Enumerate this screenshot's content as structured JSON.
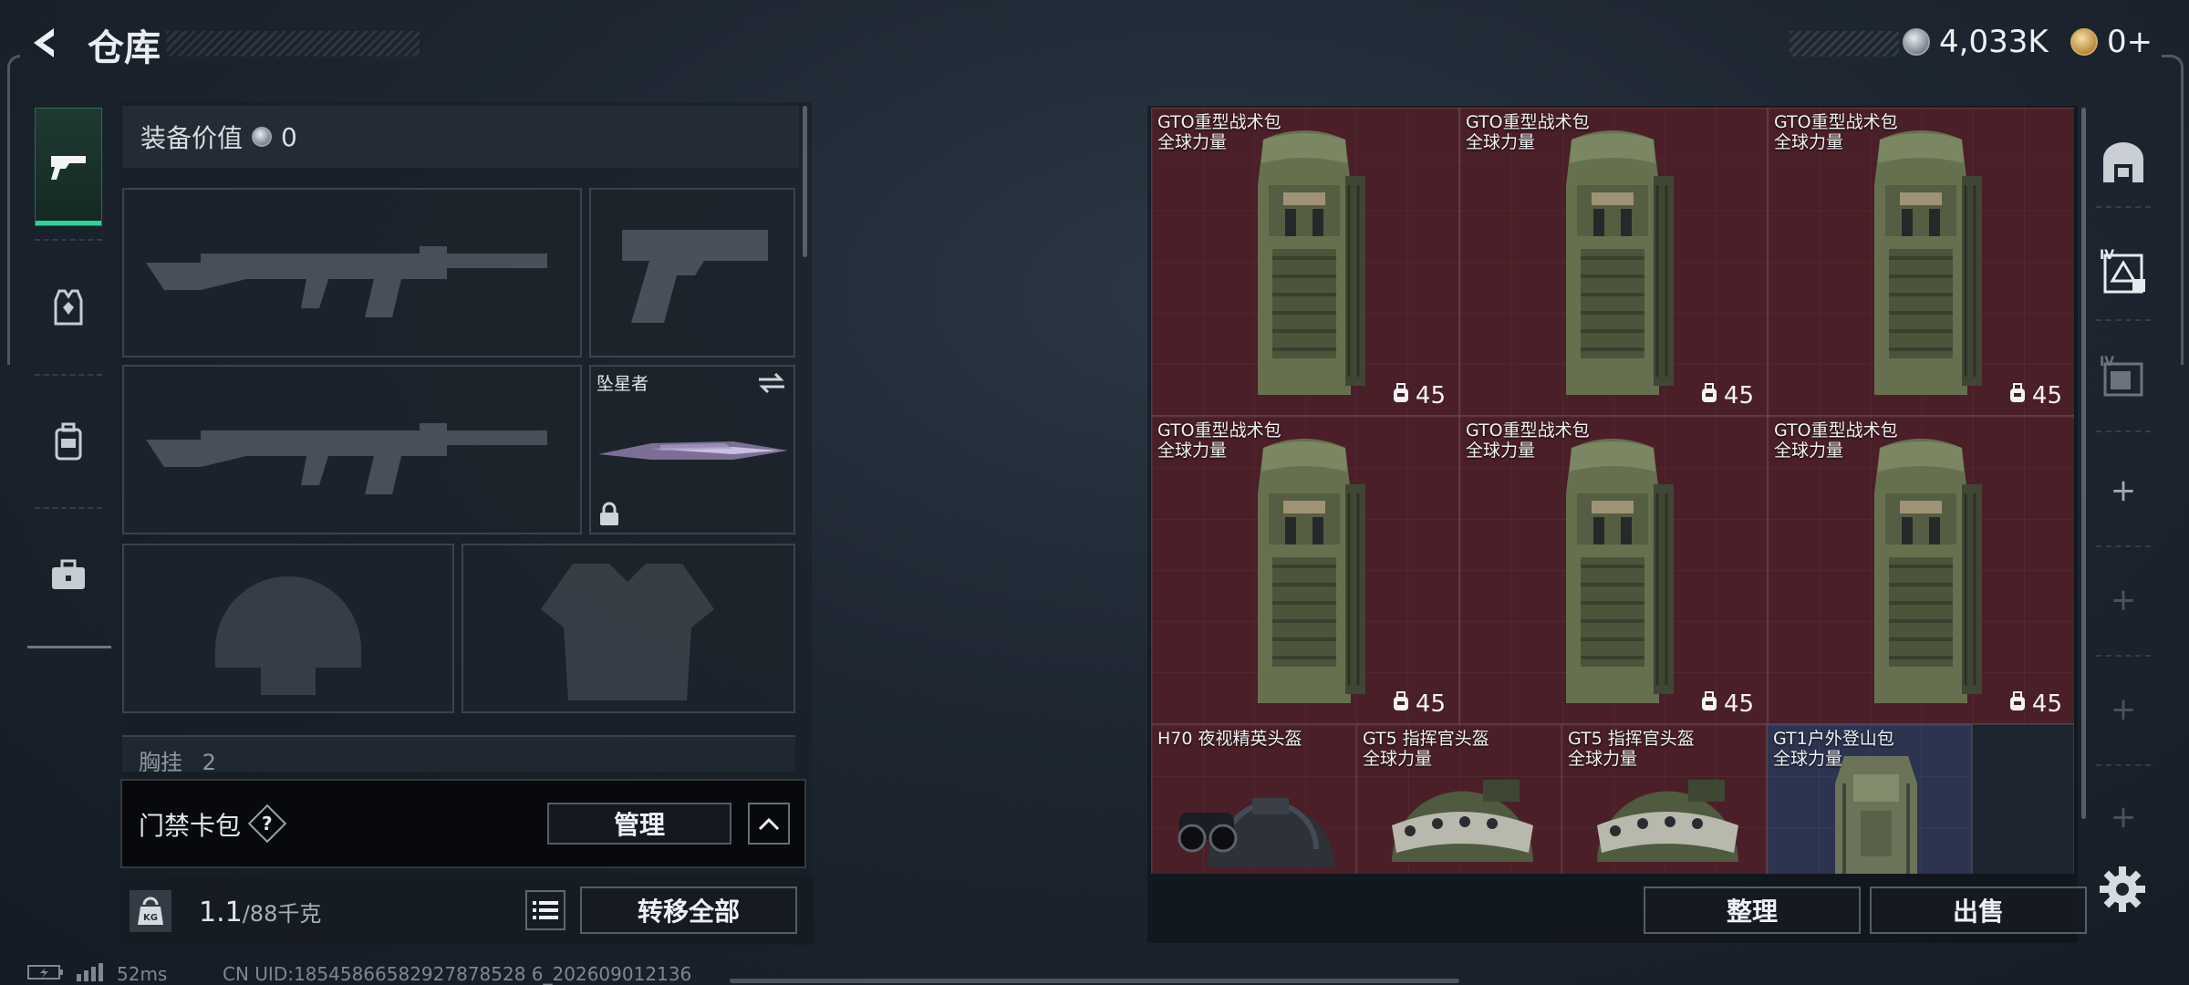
{
  "header": {
    "title": "仓库",
    "currency_silver": "4,033K",
    "currency_gold": "0+"
  },
  "equipment": {
    "value_label": "装备价值",
    "value": "0",
    "melee_name": "坠星者",
    "chest_label": "胸挂",
    "chest_value": "2"
  },
  "card_pack": {
    "label": "门禁卡包",
    "help": "?",
    "manage_label": "管理"
  },
  "weight": {
    "current": "1.1",
    "max": "/88千克",
    "kg_icon_text": "KG",
    "transfer_all_label": "转移全部"
  },
  "stash": {
    "items": [
      {
        "name": "GTO重型战术包",
        "sub": "全球力量",
        "cap": "45",
        "icon": "backpack-icon"
      },
      {
        "name": "GTO重型战术包",
        "sub": "全球力量",
        "cap": "45",
        "icon": "backpack-icon"
      },
      {
        "name": "GTO重型战术包",
        "sub": "全球力量",
        "cap": "45",
        "icon": "backpack-icon"
      },
      {
        "name": "GTO重型战术包",
        "sub": "全球力量",
        "cap": "45",
        "icon": "backpack-icon"
      },
      {
        "name": "GTO重型战术包",
        "sub": "全球力量",
        "cap": "45",
        "icon": "backpack-icon"
      },
      {
        "name": "GTO重型战术包",
        "sub": "全球力量",
        "cap": "45",
        "icon": "backpack-icon"
      },
      {
        "name": "H70 夜视精英头盔",
        "sub": "",
        "icon": "nvg-helmet-icon"
      },
      {
        "name": "GT5 指挥官头盔",
        "sub": "全球力量",
        "icon": "helmet-icon"
      },
      {
        "name": "GT5 指挥官头盔",
        "sub": "全球力量",
        "icon": "helmet-icon"
      },
      {
        "name": "GT1户外登山包",
        "sub": "全球力量",
        "icon": "hiking-backpack-icon"
      }
    ],
    "sort_label": "整理",
    "sell_label": "出售"
  },
  "status": {
    "ping": "52ms",
    "uid": "CN UID:18545866582927878528 6_202609012136"
  },
  "right_rail": {
    "tier_label": "IV"
  },
  "colors": {
    "accent_green": "#2fd29a",
    "item_red": "#4a1f27",
    "item_blue": "#2c3450"
  }
}
